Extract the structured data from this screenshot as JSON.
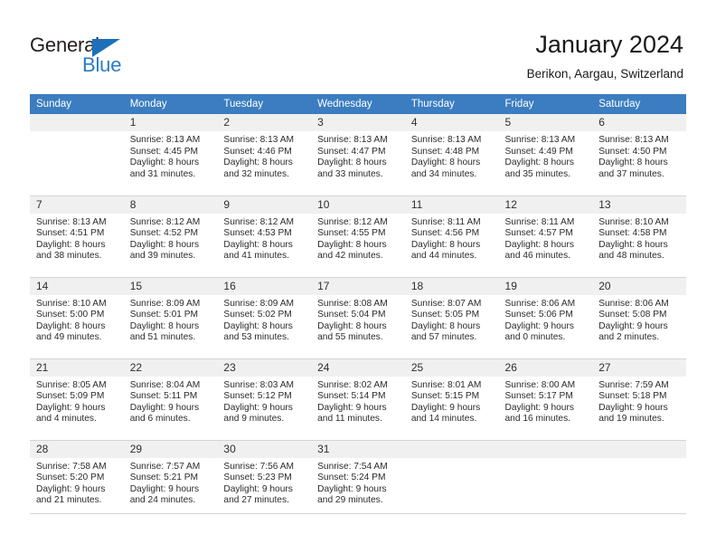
{
  "brand": {
    "name_part1": "General",
    "name_part2": "Blue",
    "triangle_color": "#1d70b8",
    "blue_color": "#2b7dc0"
  },
  "header": {
    "title": "January 2024",
    "subtitle": "Berikon, Aargau, Switzerland"
  },
  "theme": {
    "header_row_background": "#3b7dc0",
    "header_row_text": "#ffffff",
    "daynum_background": "#f0f0f0",
    "grid_line": "#d4d4d4",
    "body_text": "#2b2b2b"
  },
  "calendar": {
    "weekday_headers": [
      "Sunday",
      "Monday",
      "Tuesday",
      "Wednesday",
      "Thursday",
      "Friday",
      "Saturday"
    ],
    "weeks": [
      [
        {
          "day": "",
          "lines": []
        },
        {
          "day": "1",
          "lines": [
            "Sunrise: 8:13 AM",
            "Sunset: 4:45 PM",
            "Daylight: 8 hours",
            "and 31 minutes."
          ]
        },
        {
          "day": "2",
          "lines": [
            "Sunrise: 8:13 AM",
            "Sunset: 4:46 PM",
            "Daylight: 8 hours",
            "and 32 minutes."
          ]
        },
        {
          "day": "3",
          "lines": [
            "Sunrise: 8:13 AM",
            "Sunset: 4:47 PM",
            "Daylight: 8 hours",
            "and 33 minutes."
          ]
        },
        {
          "day": "4",
          "lines": [
            "Sunrise: 8:13 AM",
            "Sunset: 4:48 PM",
            "Daylight: 8 hours",
            "and 34 minutes."
          ]
        },
        {
          "day": "5",
          "lines": [
            "Sunrise: 8:13 AM",
            "Sunset: 4:49 PM",
            "Daylight: 8 hours",
            "and 35 minutes."
          ]
        },
        {
          "day": "6",
          "lines": [
            "Sunrise: 8:13 AM",
            "Sunset: 4:50 PM",
            "Daylight: 8 hours",
            "and 37 minutes."
          ]
        }
      ],
      [
        {
          "day": "7",
          "lines": [
            "Sunrise: 8:13 AM",
            "Sunset: 4:51 PM",
            "Daylight: 8 hours",
            "and 38 minutes."
          ]
        },
        {
          "day": "8",
          "lines": [
            "Sunrise: 8:12 AM",
            "Sunset: 4:52 PM",
            "Daylight: 8 hours",
            "and 39 minutes."
          ]
        },
        {
          "day": "9",
          "lines": [
            "Sunrise: 8:12 AM",
            "Sunset: 4:53 PM",
            "Daylight: 8 hours",
            "and 41 minutes."
          ]
        },
        {
          "day": "10",
          "lines": [
            "Sunrise: 8:12 AM",
            "Sunset: 4:55 PM",
            "Daylight: 8 hours",
            "and 42 minutes."
          ]
        },
        {
          "day": "11",
          "lines": [
            "Sunrise: 8:11 AM",
            "Sunset: 4:56 PM",
            "Daylight: 8 hours",
            "and 44 minutes."
          ]
        },
        {
          "day": "12",
          "lines": [
            "Sunrise: 8:11 AM",
            "Sunset: 4:57 PM",
            "Daylight: 8 hours",
            "and 46 minutes."
          ]
        },
        {
          "day": "13",
          "lines": [
            "Sunrise: 8:10 AM",
            "Sunset: 4:58 PM",
            "Daylight: 8 hours",
            "and 48 minutes."
          ]
        }
      ],
      [
        {
          "day": "14",
          "lines": [
            "Sunrise: 8:10 AM",
            "Sunset: 5:00 PM",
            "Daylight: 8 hours",
            "and 49 minutes."
          ]
        },
        {
          "day": "15",
          "lines": [
            "Sunrise: 8:09 AM",
            "Sunset: 5:01 PM",
            "Daylight: 8 hours",
            "and 51 minutes."
          ]
        },
        {
          "day": "16",
          "lines": [
            "Sunrise: 8:09 AM",
            "Sunset: 5:02 PM",
            "Daylight: 8 hours",
            "and 53 minutes."
          ]
        },
        {
          "day": "17",
          "lines": [
            "Sunrise: 8:08 AM",
            "Sunset: 5:04 PM",
            "Daylight: 8 hours",
            "and 55 minutes."
          ]
        },
        {
          "day": "18",
          "lines": [
            "Sunrise: 8:07 AM",
            "Sunset: 5:05 PM",
            "Daylight: 8 hours",
            "and 57 minutes."
          ]
        },
        {
          "day": "19",
          "lines": [
            "Sunrise: 8:06 AM",
            "Sunset: 5:06 PM",
            "Daylight: 9 hours",
            "and 0 minutes."
          ]
        },
        {
          "day": "20",
          "lines": [
            "Sunrise: 8:06 AM",
            "Sunset: 5:08 PM",
            "Daylight: 9 hours",
            "and 2 minutes."
          ]
        }
      ],
      [
        {
          "day": "21",
          "lines": [
            "Sunrise: 8:05 AM",
            "Sunset: 5:09 PM",
            "Daylight: 9 hours",
            "and 4 minutes."
          ]
        },
        {
          "day": "22",
          "lines": [
            "Sunrise: 8:04 AM",
            "Sunset: 5:11 PM",
            "Daylight: 9 hours",
            "and 6 minutes."
          ]
        },
        {
          "day": "23",
          "lines": [
            "Sunrise: 8:03 AM",
            "Sunset: 5:12 PM",
            "Daylight: 9 hours",
            "and 9 minutes."
          ]
        },
        {
          "day": "24",
          "lines": [
            "Sunrise: 8:02 AM",
            "Sunset: 5:14 PM",
            "Daylight: 9 hours",
            "and 11 minutes."
          ]
        },
        {
          "day": "25",
          "lines": [
            "Sunrise: 8:01 AM",
            "Sunset: 5:15 PM",
            "Daylight: 9 hours",
            "and 14 minutes."
          ]
        },
        {
          "day": "26",
          "lines": [
            "Sunrise: 8:00 AM",
            "Sunset: 5:17 PM",
            "Daylight: 9 hours",
            "and 16 minutes."
          ]
        },
        {
          "day": "27",
          "lines": [
            "Sunrise: 7:59 AM",
            "Sunset: 5:18 PM",
            "Daylight: 9 hours",
            "and 19 minutes."
          ]
        }
      ],
      [
        {
          "day": "28",
          "lines": [
            "Sunrise: 7:58 AM",
            "Sunset: 5:20 PM",
            "Daylight: 9 hours",
            "and 21 minutes."
          ]
        },
        {
          "day": "29",
          "lines": [
            "Sunrise: 7:57 AM",
            "Sunset: 5:21 PM",
            "Daylight: 9 hours",
            "and 24 minutes."
          ]
        },
        {
          "day": "30",
          "lines": [
            "Sunrise: 7:56 AM",
            "Sunset: 5:23 PM",
            "Daylight: 9 hours",
            "and 27 minutes."
          ]
        },
        {
          "day": "31",
          "lines": [
            "Sunrise: 7:54 AM",
            "Sunset: 5:24 PM",
            "Daylight: 9 hours",
            "and 29 minutes."
          ]
        },
        {
          "day": "",
          "lines": []
        },
        {
          "day": "",
          "lines": []
        },
        {
          "day": "",
          "lines": []
        }
      ]
    ]
  }
}
